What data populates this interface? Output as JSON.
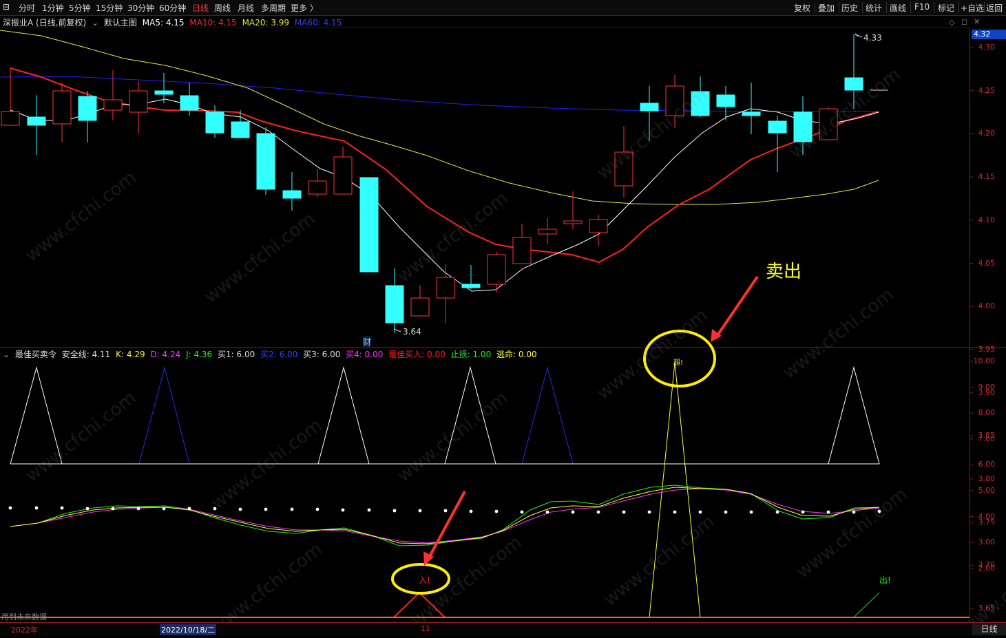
{
  "toolbar": {
    "periods": [
      "分时",
      "1分钟",
      "5分钟",
      "15分钟",
      "30分钟",
      "60分钟",
      "日线",
      "周线",
      "月线",
      "多周期",
      "更多 〉"
    ],
    "active_period": "日线",
    "right_tools": [
      "复权",
      "叠加",
      "历史",
      "统计",
      "画线",
      "F10",
      "标记",
      "+自选",
      "返回"
    ]
  },
  "main_chart": {
    "stock": "深振业A (日线,前复权)",
    "template": "默认主图",
    "ma5": "MA5: 4.15",
    "ma10": "MA10: 4.15",
    "ma20": "MA20: 3.99",
    "ma60": "MA60: 4.15",
    "current_price": "4.32",
    "high_label": "4.33",
    "low_label": "3.64",
    "fin_marker": "财",
    "y_ticks": [
      "4.30",
      "4.25",
      "4.20",
      "4.15",
      "4.10",
      "4.05",
      "4.00",
      "3.95",
      "3.90",
      "3.85",
      "3.80",
      "3.75",
      "3.70",
      "3.65"
    ]
  },
  "indicator": {
    "name": "最佳买卖令",
    "safe": "安全线: 4.11",
    "k": "K: 4.29",
    "d": "D: 4.24",
    "j": "J: 4.36",
    "b1": "买1: 6.00",
    "b2": "买2: 6.00",
    "b3": "买3: 6.00",
    "b4": "买4: 0.00",
    "best": "最佳买入: 0.00",
    "stop": "止损: 1.00",
    "escape": "逃命: 0.00",
    "y_ticks": [
      "10.00",
      "9.00",
      "8.00",
      "7.00",
      "6.00",
      "5.00",
      "4.00",
      "3.00",
      "2.00"
    ],
    "buy_mark": "入!",
    "sell_mark": "出!",
    "top_mark": "超!"
  },
  "annotation": {
    "sell_text": "卖出"
  },
  "bottom": {
    "year": "2022年",
    "cursor_date": "2022/10/18/二",
    "month": "11",
    "period_tab": "日线",
    "note": "用到未来数据"
  },
  "watermark": "www.cfchi.com",
  "colors": {
    "up": "#ff3333",
    "down": "#33ffff",
    "ma5": "#ffffff",
    "ma10": "#ff2020",
    "ma20": "#e6e64a",
    "ma60": "#2020ff"
  }
}
